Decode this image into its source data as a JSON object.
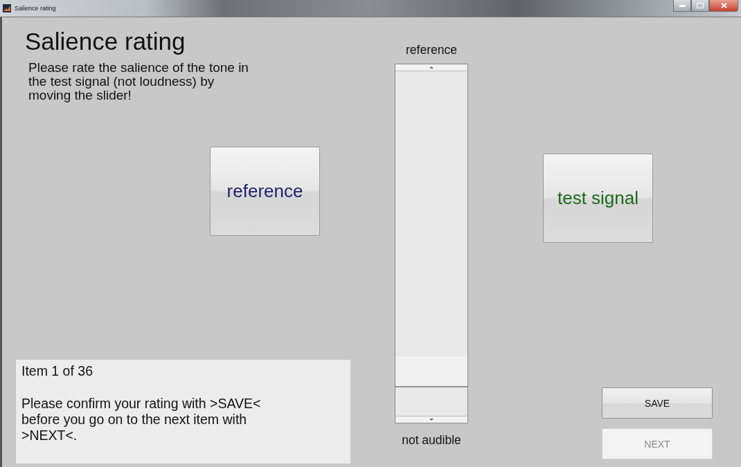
{
  "window": {
    "title": "Salience rating"
  },
  "heading": "Salience rating",
  "instructions": "Please rate the salience of the tone in the test signal (not loudness) by moving the slider!",
  "play_buttons": [
    {
      "label": "reference",
      "color": "#1f1f6b"
    },
    {
      "label": "test signal",
      "color": "#1c6a1c"
    }
  ],
  "slider": {
    "top_label": "reference",
    "bottom_label": "not audible",
    "level": 0.09
  },
  "info": {
    "item": "Item 1 of 36",
    "message": "Please confirm your rating with >SAVE< before you go on to the next item with >NEXT<."
  },
  "actions": [
    {
      "label": "SAVE",
      "disabled": false
    },
    {
      "label": "NEXT",
      "disabled": true
    }
  ]
}
